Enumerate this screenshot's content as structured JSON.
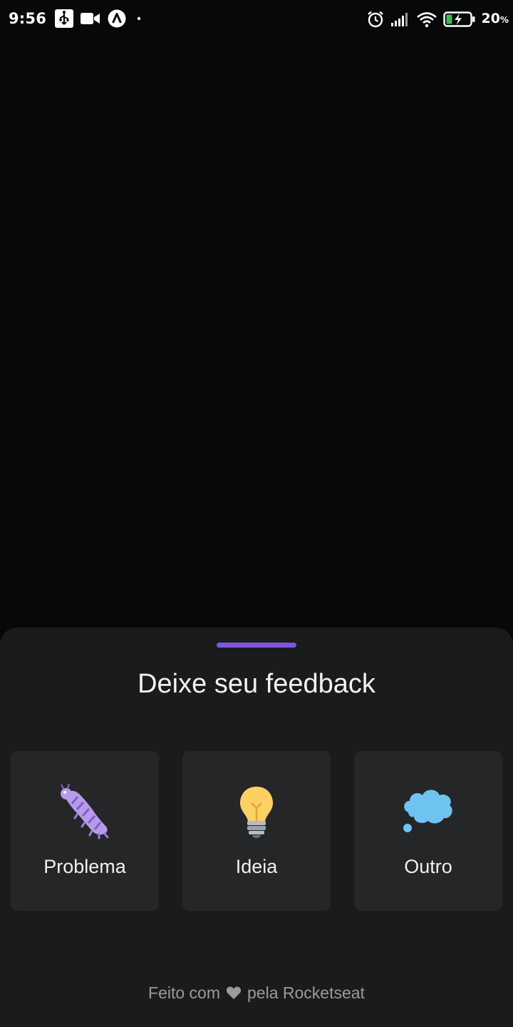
{
  "status_bar": {
    "time": "9:56",
    "battery_percent": "20",
    "battery_unit": "%",
    "icons": [
      "usb-icon",
      "video-camera-icon",
      "app-notification-icon",
      "dot-icon",
      "alarm-icon",
      "signal-icon",
      "wifi-icon",
      "battery-charging-icon"
    ]
  },
  "sheet": {
    "title": "Deixe seu feedback",
    "handle_color": "#7e55e0",
    "options": [
      {
        "label": "Problema",
        "icon": "bug-icon"
      },
      {
        "label": "Ideia",
        "icon": "lightbulb-icon"
      },
      {
        "label": "Outro",
        "icon": "thought-bubble-icon"
      }
    ],
    "footer": {
      "prefix": "Feito com",
      "icon": "heart-icon",
      "suffix": "pela Rocketseat"
    }
  },
  "colors": {
    "background": "#070808",
    "sheet": "#1a1b1c",
    "card": "#252627",
    "accent": "#7e55e0"
  }
}
